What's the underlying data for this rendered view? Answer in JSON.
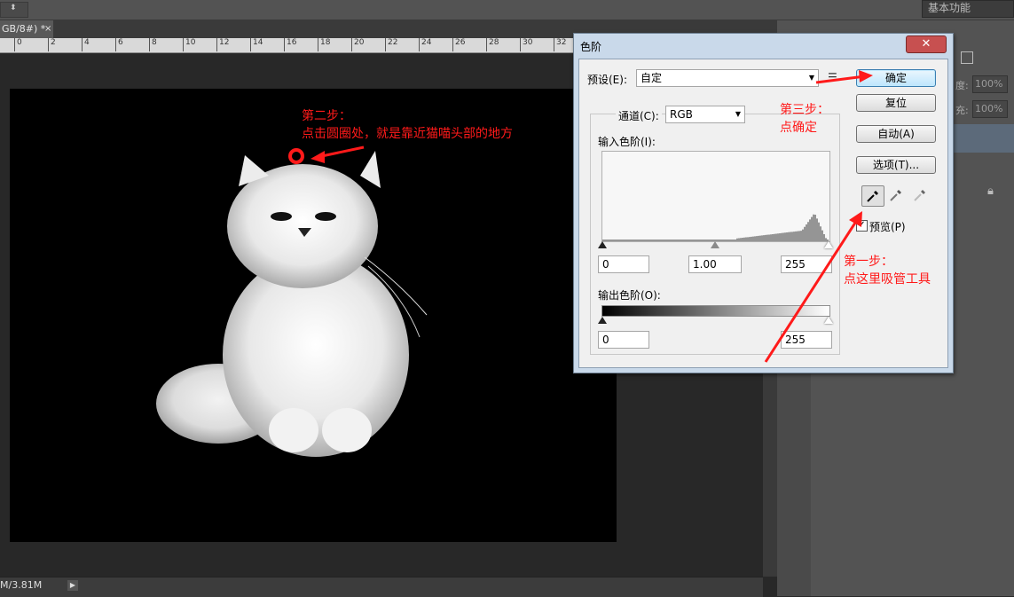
{
  "top_bar": {
    "workspace": "基本功能"
  },
  "document": {
    "tab_title": "GB/8#) *",
    "close_glyph": "×"
  },
  "ruler": {
    "ticks": [
      "0",
      "2",
      "4",
      "6",
      "8",
      "10",
      "12",
      "14",
      "16",
      "18",
      "20",
      "22",
      "24",
      "26",
      "28",
      "30",
      "32"
    ]
  },
  "status": {
    "info": "M/3.81M",
    "arrow": "▶"
  },
  "right_panel": {
    "opacity_label": "度:",
    "opacity_value": "100%",
    "fill_label": "充:",
    "fill_value": "100%",
    "collapse_glyph": "«"
  },
  "dialog": {
    "title": "色阶",
    "close": "✕",
    "preset_label": "预设(E):",
    "preset_value": "自定",
    "channel_label": "通道(C):",
    "channel_value": "RGB",
    "input_levels_label": "输入色阶(I):",
    "input_black": "0",
    "input_gamma": "1.00",
    "input_white": "255",
    "output_levels_label": "输出色阶(O):",
    "output_black": "0",
    "output_white": "255",
    "buttons": {
      "ok": "确定",
      "reset": "复位",
      "auto": "自动(A)",
      "options": "选项(T)..."
    },
    "preview_label": "预览(P)",
    "preview_checked": true
  },
  "annotations": {
    "step2_line1": "第二步：",
    "step2_line2": "点击圆圈处，就是靠近猫喵头部的地方",
    "step3_line1": "第三步：",
    "step3_line2": "点确定",
    "step1_line1": "第一步：",
    "step1_line2": "点这里吸管工具",
    "color": "#ff1a1a"
  }
}
